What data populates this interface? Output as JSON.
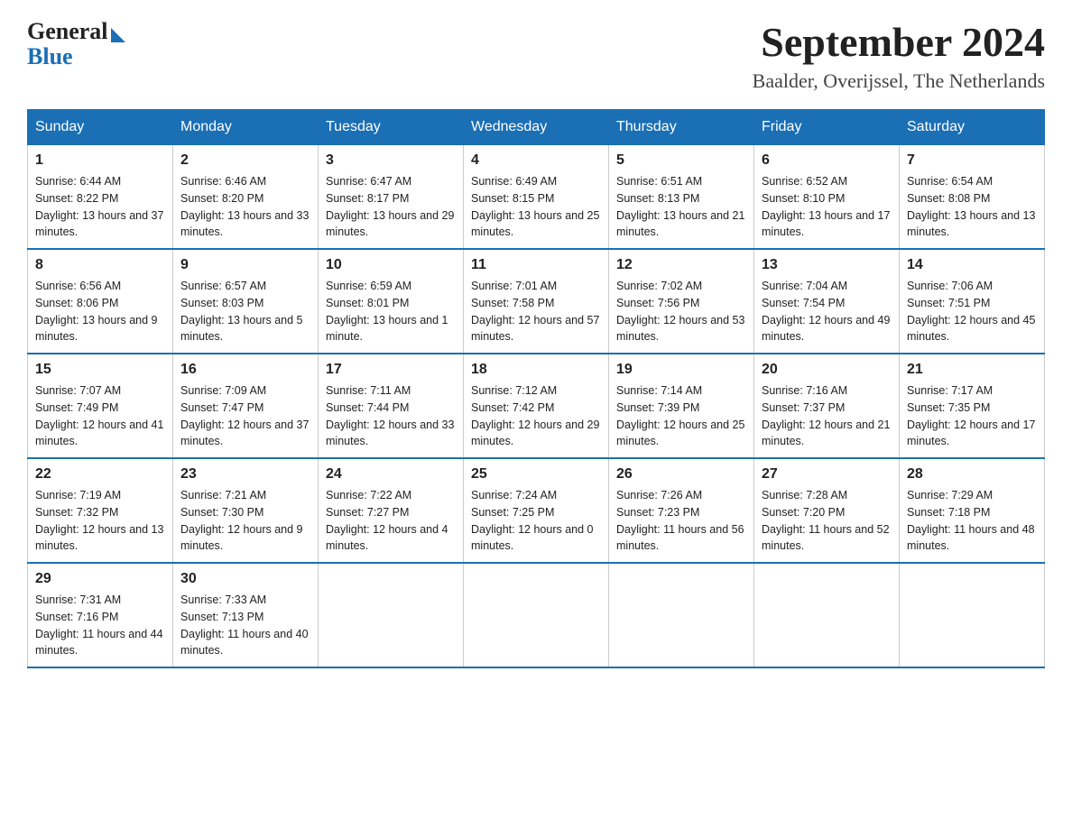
{
  "logo": {
    "text_general": "General",
    "triangle_symbol": "▶",
    "text_blue": "Blue"
  },
  "title": "September 2024",
  "subtitle": "Baalder, Overijssel, The Netherlands",
  "days_of_week": [
    "Sunday",
    "Monday",
    "Tuesday",
    "Wednesday",
    "Thursday",
    "Friday",
    "Saturday"
  ],
  "weeks": [
    [
      {
        "day": "1",
        "sunrise": "6:44 AM",
        "sunset": "8:22 PM",
        "daylight": "13 hours and 37 minutes."
      },
      {
        "day": "2",
        "sunrise": "6:46 AM",
        "sunset": "8:20 PM",
        "daylight": "13 hours and 33 minutes."
      },
      {
        "day": "3",
        "sunrise": "6:47 AM",
        "sunset": "8:17 PM",
        "daylight": "13 hours and 29 minutes."
      },
      {
        "day": "4",
        "sunrise": "6:49 AM",
        "sunset": "8:15 PM",
        "daylight": "13 hours and 25 minutes."
      },
      {
        "day": "5",
        "sunrise": "6:51 AM",
        "sunset": "8:13 PM",
        "daylight": "13 hours and 21 minutes."
      },
      {
        "day": "6",
        "sunrise": "6:52 AM",
        "sunset": "8:10 PM",
        "daylight": "13 hours and 17 minutes."
      },
      {
        "day": "7",
        "sunrise": "6:54 AM",
        "sunset": "8:08 PM",
        "daylight": "13 hours and 13 minutes."
      }
    ],
    [
      {
        "day": "8",
        "sunrise": "6:56 AM",
        "sunset": "8:06 PM",
        "daylight": "13 hours and 9 minutes."
      },
      {
        "day": "9",
        "sunrise": "6:57 AM",
        "sunset": "8:03 PM",
        "daylight": "13 hours and 5 minutes."
      },
      {
        "day": "10",
        "sunrise": "6:59 AM",
        "sunset": "8:01 PM",
        "daylight": "13 hours and 1 minute."
      },
      {
        "day": "11",
        "sunrise": "7:01 AM",
        "sunset": "7:58 PM",
        "daylight": "12 hours and 57 minutes."
      },
      {
        "day": "12",
        "sunrise": "7:02 AM",
        "sunset": "7:56 PM",
        "daylight": "12 hours and 53 minutes."
      },
      {
        "day": "13",
        "sunrise": "7:04 AM",
        "sunset": "7:54 PM",
        "daylight": "12 hours and 49 minutes."
      },
      {
        "day": "14",
        "sunrise": "7:06 AM",
        "sunset": "7:51 PM",
        "daylight": "12 hours and 45 minutes."
      }
    ],
    [
      {
        "day": "15",
        "sunrise": "7:07 AM",
        "sunset": "7:49 PM",
        "daylight": "12 hours and 41 minutes."
      },
      {
        "day": "16",
        "sunrise": "7:09 AM",
        "sunset": "7:47 PM",
        "daylight": "12 hours and 37 minutes."
      },
      {
        "day": "17",
        "sunrise": "7:11 AM",
        "sunset": "7:44 PM",
        "daylight": "12 hours and 33 minutes."
      },
      {
        "day": "18",
        "sunrise": "7:12 AM",
        "sunset": "7:42 PM",
        "daylight": "12 hours and 29 minutes."
      },
      {
        "day": "19",
        "sunrise": "7:14 AM",
        "sunset": "7:39 PM",
        "daylight": "12 hours and 25 minutes."
      },
      {
        "day": "20",
        "sunrise": "7:16 AM",
        "sunset": "7:37 PM",
        "daylight": "12 hours and 21 minutes."
      },
      {
        "day": "21",
        "sunrise": "7:17 AM",
        "sunset": "7:35 PM",
        "daylight": "12 hours and 17 minutes."
      }
    ],
    [
      {
        "day": "22",
        "sunrise": "7:19 AM",
        "sunset": "7:32 PM",
        "daylight": "12 hours and 13 minutes."
      },
      {
        "day": "23",
        "sunrise": "7:21 AM",
        "sunset": "7:30 PM",
        "daylight": "12 hours and 9 minutes."
      },
      {
        "day": "24",
        "sunrise": "7:22 AM",
        "sunset": "7:27 PM",
        "daylight": "12 hours and 4 minutes."
      },
      {
        "day": "25",
        "sunrise": "7:24 AM",
        "sunset": "7:25 PM",
        "daylight": "12 hours and 0 minutes."
      },
      {
        "day": "26",
        "sunrise": "7:26 AM",
        "sunset": "7:23 PM",
        "daylight": "11 hours and 56 minutes."
      },
      {
        "day": "27",
        "sunrise": "7:28 AM",
        "sunset": "7:20 PM",
        "daylight": "11 hours and 52 minutes."
      },
      {
        "day": "28",
        "sunrise": "7:29 AM",
        "sunset": "7:18 PM",
        "daylight": "11 hours and 48 minutes."
      }
    ],
    [
      {
        "day": "29",
        "sunrise": "7:31 AM",
        "sunset": "7:16 PM",
        "daylight": "11 hours and 44 minutes."
      },
      {
        "day": "30",
        "sunrise": "7:33 AM",
        "sunset": "7:13 PM",
        "daylight": "11 hours and 40 minutes."
      },
      null,
      null,
      null,
      null,
      null
    ]
  ]
}
